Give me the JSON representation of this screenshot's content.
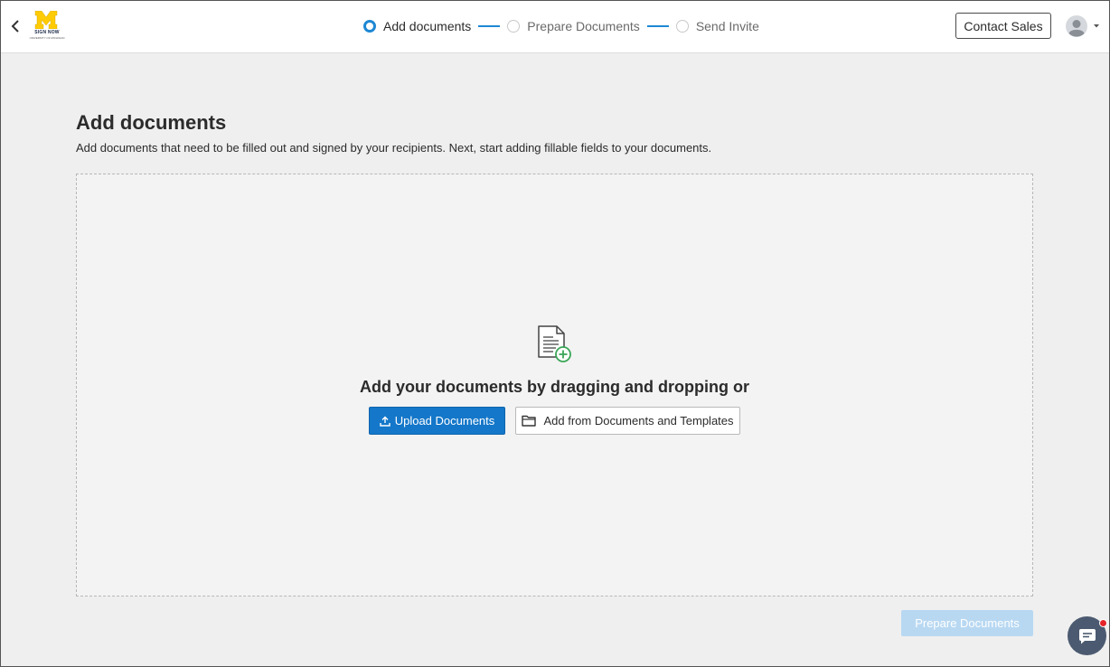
{
  "header": {
    "back_icon": "chevron-left-icon",
    "logo": {
      "letter": "M",
      "line1": "SIGN NOW",
      "line2": "UNIVERSITY OF MICHIGAN",
      "color": "#ffcb05"
    },
    "steps": [
      {
        "label": "Add documents",
        "active": true
      },
      {
        "label": "Prepare Documents",
        "active": false
      },
      {
        "label": "Send Invite",
        "active": false
      }
    ],
    "contact_sales_label": "Contact Sales",
    "avatar_icon": "user-avatar-icon",
    "dropdown_icon": "caret-down-icon"
  },
  "main": {
    "title": "Add documents",
    "subtitle": "Add documents that need to be filled out and signed by your recipients. Next, start adding fillable fields to your documents.",
    "dropzone": {
      "icon": "document-add-icon",
      "text": "Add your documents by dragging and dropping or",
      "upload_label": "Upload Documents",
      "templates_label": "Add from Documents and Templates"
    },
    "prepare_label": "Prepare Documents"
  },
  "chat": {
    "icon": "chat-icon",
    "has_notification": true
  },
  "colors": {
    "accent": "#1477c9",
    "step_active": "#1e88d4",
    "disabled_button": "#b8d8f2",
    "add_icon_green": "#3aa657",
    "notification": "#e5242a"
  }
}
